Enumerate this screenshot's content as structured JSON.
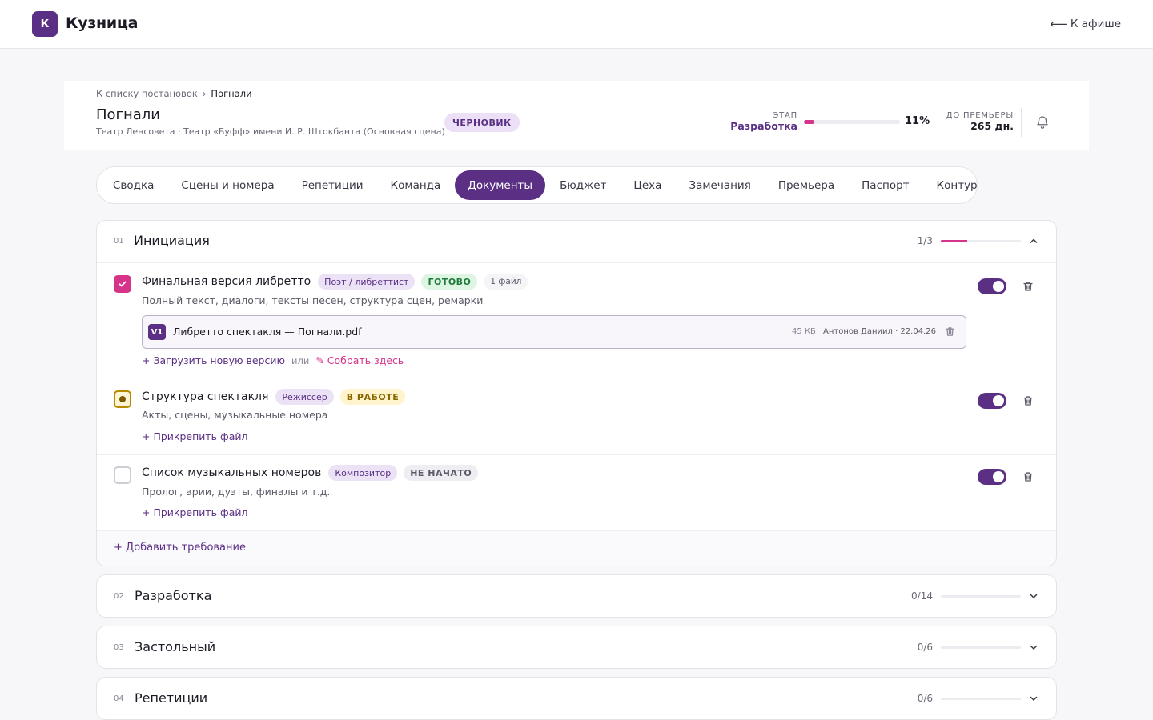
{
  "app": {
    "logo_letter": "К",
    "name": "Кузница",
    "back_label": "К афише"
  },
  "header": {
    "breadcrumb_link": "К списку постановок",
    "breadcrumb_sep": "›",
    "breadcrumb_current": "Погнали",
    "title": "Погнали",
    "subtitle": "Театр Ленсовета · Театр «Буфф» имени И. Р. Штокбанта (Основная сцена)",
    "status_badge": "ЧЕРНОВИК",
    "stage_label": "ЭТАП",
    "stage_value": "Разработка",
    "stage_progress": 0.11,
    "stage_percent": "11%",
    "premiere_label": "ДО ПРЕМЬЕРЫ",
    "premiere_value": "265 дн."
  },
  "tabs": [
    {
      "label": "Сводка"
    },
    {
      "label": "Сцены и номера"
    },
    {
      "label": "Репетиции"
    },
    {
      "label": "Команда"
    },
    {
      "label": "Документы",
      "active": true
    },
    {
      "label": "Бюджет"
    },
    {
      "label": "Цеха"
    },
    {
      "label": "Замечания"
    },
    {
      "label": "Премьера"
    },
    {
      "label": "Паспорт"
    },
    {
      "label": "Контур"
    }
  ],
  "sections": [
    {
      "num": "01",
      "title": "Инициация",
      "count": "1/3",
      "progress": 0.33,
      "expanded": true,
      "requirements": [
        {
          "title": "Финальная версия либретто",
          "role": "Поэт / либреттист",
          "status": "ГОТОВО",
          "files_label": "1 файл",
          "desc": "Полный текст, диалоги, тексты песен, структура сцен, ремарки",
          "file": {
            "version": "V1",
            "name": "Либретто спектакля — Погнали.pdf",
            "size": "45 КБ",
            "meta": "Антонов Даниил · 22.04.26"
          },
          "upload_label": "Загрузить новую версию",
          "or_label": "или",
          "compose_label": "Собрать здесь"
        },
        {
          "title": "Структура спектакля",
          "role": "Режиссёр",
          "status": "В РАБОТЕ",
          "desc": "Акты, сцены, музыкальные номера",
          "attach_label": "Прикрепить файл"
        },
        {
          "title": "Список музыкальных номеров",
          "role": "Композитор",
          "status": "НЕ НАЧАТО",
          "desc": "Пролог, арии, дуэты, финалы и т.д.",
          "attach_label": "Прикрепить файл"
        }
      ],
      "add_label": "Добавить требование"
    },
    {
      "num": "02",
      "title": "Разработка",
      "count": "0/14",
      "progress": 0,
      "expanded": false
    },
    {
      "num": "03",
      "title": "Застольный",
      "count": "0/6",
      "progress": 0,
      "expanded": false
    },
    {
      "num": "04",
      "title": "Репетиции",
      "count": "0/6",
      "progress": 0,
      "expanded": false
    }
  ],
  "colors": {
    "accent": "#5a2f84",
    "progress": "#d6338a"
  },
  "icons": [
    "back-arrow-icon",
    "bell-icon",
    "check-icon",
    "trash-icon",
    "chevron-up-icon",
    "chevron-down-icon",
    "plus-icon",
    "compose-icon"
  ]
}
